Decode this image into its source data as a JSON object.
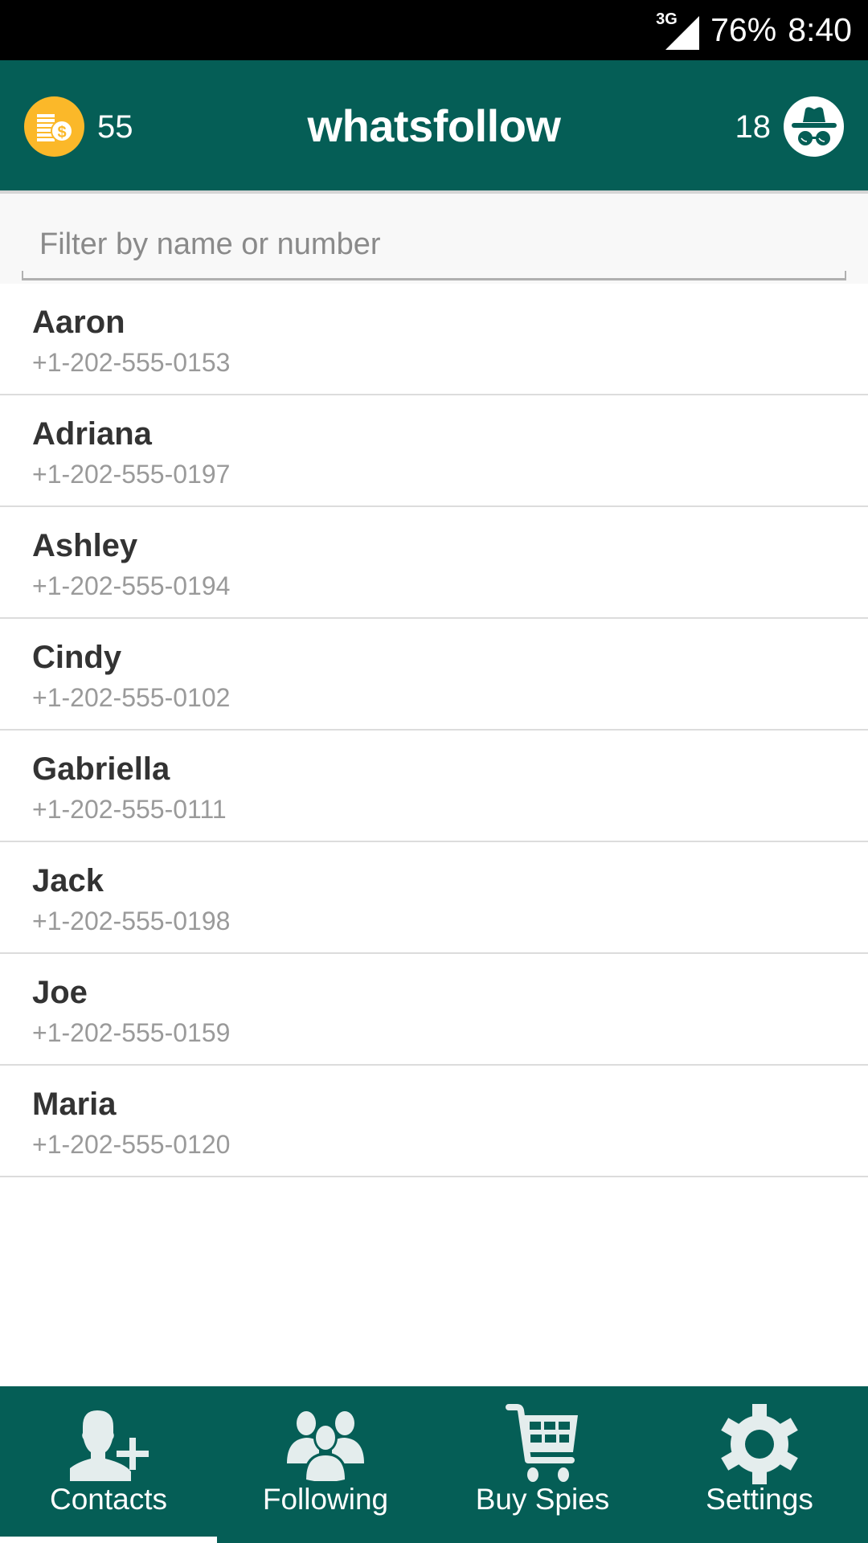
{
  "status_bar": {
    "network_type": "3G",
    "battery": "76%",
    "time": "8:40"
  },
  "app_bar": {
    "title": "whatsfollow",
    "coins_count": "55",
    "coins_icon": "coins-icon",
    "spies_count": "18",
    "spies_icon": "incognito-spy-icon"
  },
  "filter": {
    "value": "",
    "placeholder": "Filter by name or number"
  },
  "contacts": [
    {
      "name": "Aaron",
      "phone": "+1-202-555-0153"
    },
    {
      "name": "Adriana",
      "phone": "+1-202-555-0197"
    },
    {
      "name": "Ashley",
      "phone": "+1-202-555-0194"
    },
    {
      "name": "Cindy",
      "phone": "+1-202-555-0102"
    },
    {
      "name": "Gabriella",
      "phone": "+1-202-555-0111"
    },
    {
      "name": "Jack",
      "phone": "+1-202-555-0198"
    },
    {
      "name": "Joe",
      "phone": "+1-202-555-0159"
    },
    {
      "name": "Maria",
      "phone": "+1-202-555-0120"
    }
  ],
  "bottom_nav": {
    "active_index": 0,
    "items": [
      {
        "label": "Contacts",
        "icon": "add-contact-icon"
      },
      {
        "label": "Following",
        "icon": "group-icon"
      },
      {
        "label": "Buy Spies",
        "icon": "cart-icon"
      },
      {
        "label": "Settings",
        "icon": "gear-icon"
      }
    ]
  },
  "colors": {
    "primary": "#055e56",
    "coin": "#fbb829",
    "nav_icon": "#e4eded",
    "name_text": "#333333",
    "phone_text": "#9a9a9a"
  }
}
